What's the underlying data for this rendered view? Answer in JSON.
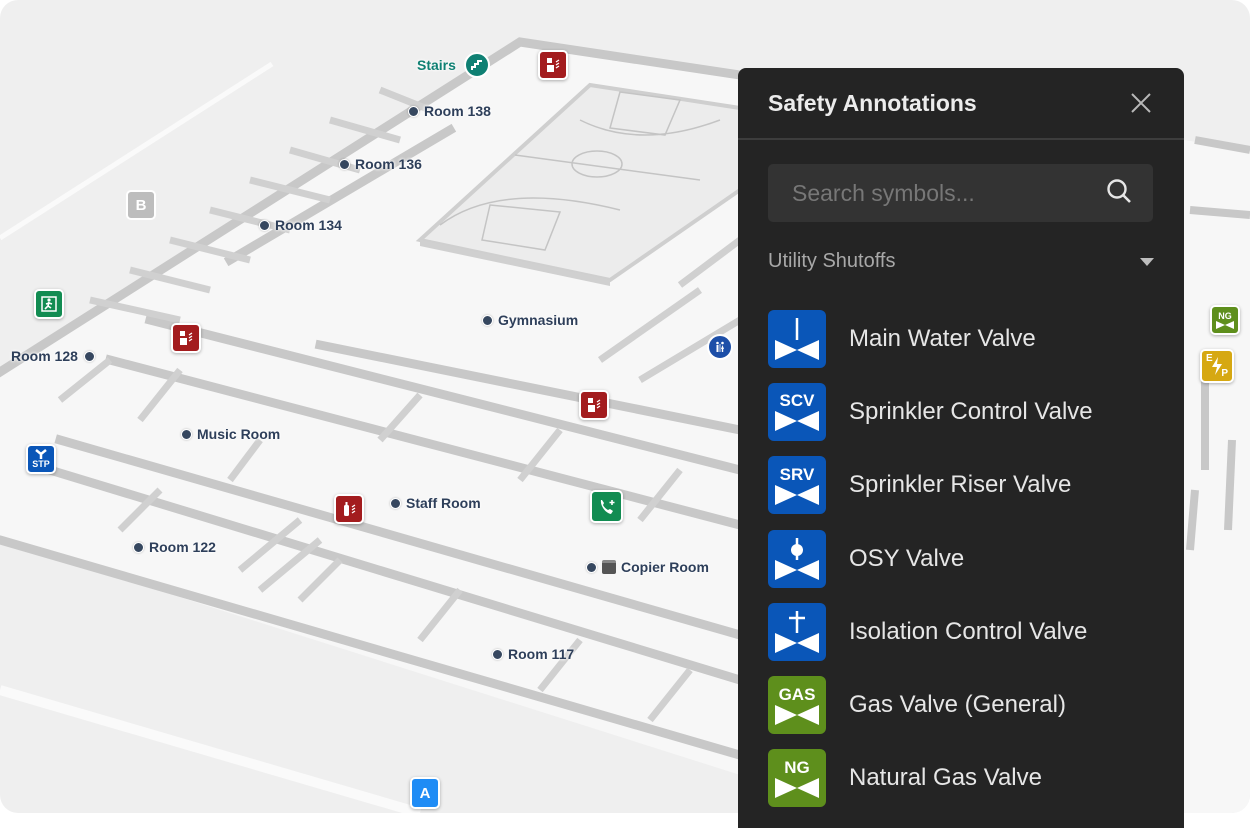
{
  "panel": {
    "title": "Safety Annotations",
    "close_icon": "close-icon",
    "search": {
      "placeholder": "Search symbols...",
      "value": "",
      "icon": "search-icon"
    },
    "section": {
      "label": "Utility Shutoffs",
      "icon": "caret-down-icon"
    },
    "items": [
      {
        "label": "Main Water Valve",
        "code": "",
        "glyph": "stem",
        "color": "#0a56b8"
      },
      {
        "label": "Sprinkler Control Valve",
        "code": "SCV",
        "glyph": "text",
        "color": "#0a56b8"
      },
      {
        "label": "Sprinkler Riser Valve",
        "code": "SRV",
        "glyph": "text",
        "color": "#0a56b8"
      },
      {
        "label": "OSY Valve",
        "code": "",
        "glyph": "ball",
        "color": "#0a56b8"
      },
      {
        "label": "Isolation Control Valve",
        "code": "",
        "glyph": "cross",
        "color": "#0a56b8"
      },
      {
        "label": "Gas Valve (General)",
        "code": "GAS",
        "glyph": "text",
        "color": "#5e8f1c"
      },
      {
        "label": "Natural Gas Valve",
        "code": "NG",
        "glyph": "text",
        "color": "#5e8f1c"
      }
    ]
  },
  "map": {
    "rooms": {
      "room138": "Room 138",
      "room136": "Room 136",
      "room134": "Room 134",
      "room128": "Room 128",
      "gymnasium": "Gymnasium",
      "music": "Music Room",
      "staff": "Staff Room",
      "room122": "Room 122",
      "copier": "Copier Room",
      "room117": "Room 117"
    },
    "stairs": "Stairs",
    "markers": {
      "b": "B",
      "a": "A"
    },
    "badges": {
      "stp": "STP",
      "ng": "NG",
      "ep_e": "E",
      "ep_p": "P"
    },
    "colors": {
      "fire": "#a31c1e",
      "safety_green": "#128c52",
      "water_blue": "#0a56b8",
      "gas_green": "#5e8f1c",
      "electric_yellow": "#d6a812",
      "marker_a": "#1f8cf5"
    }
  }
}
